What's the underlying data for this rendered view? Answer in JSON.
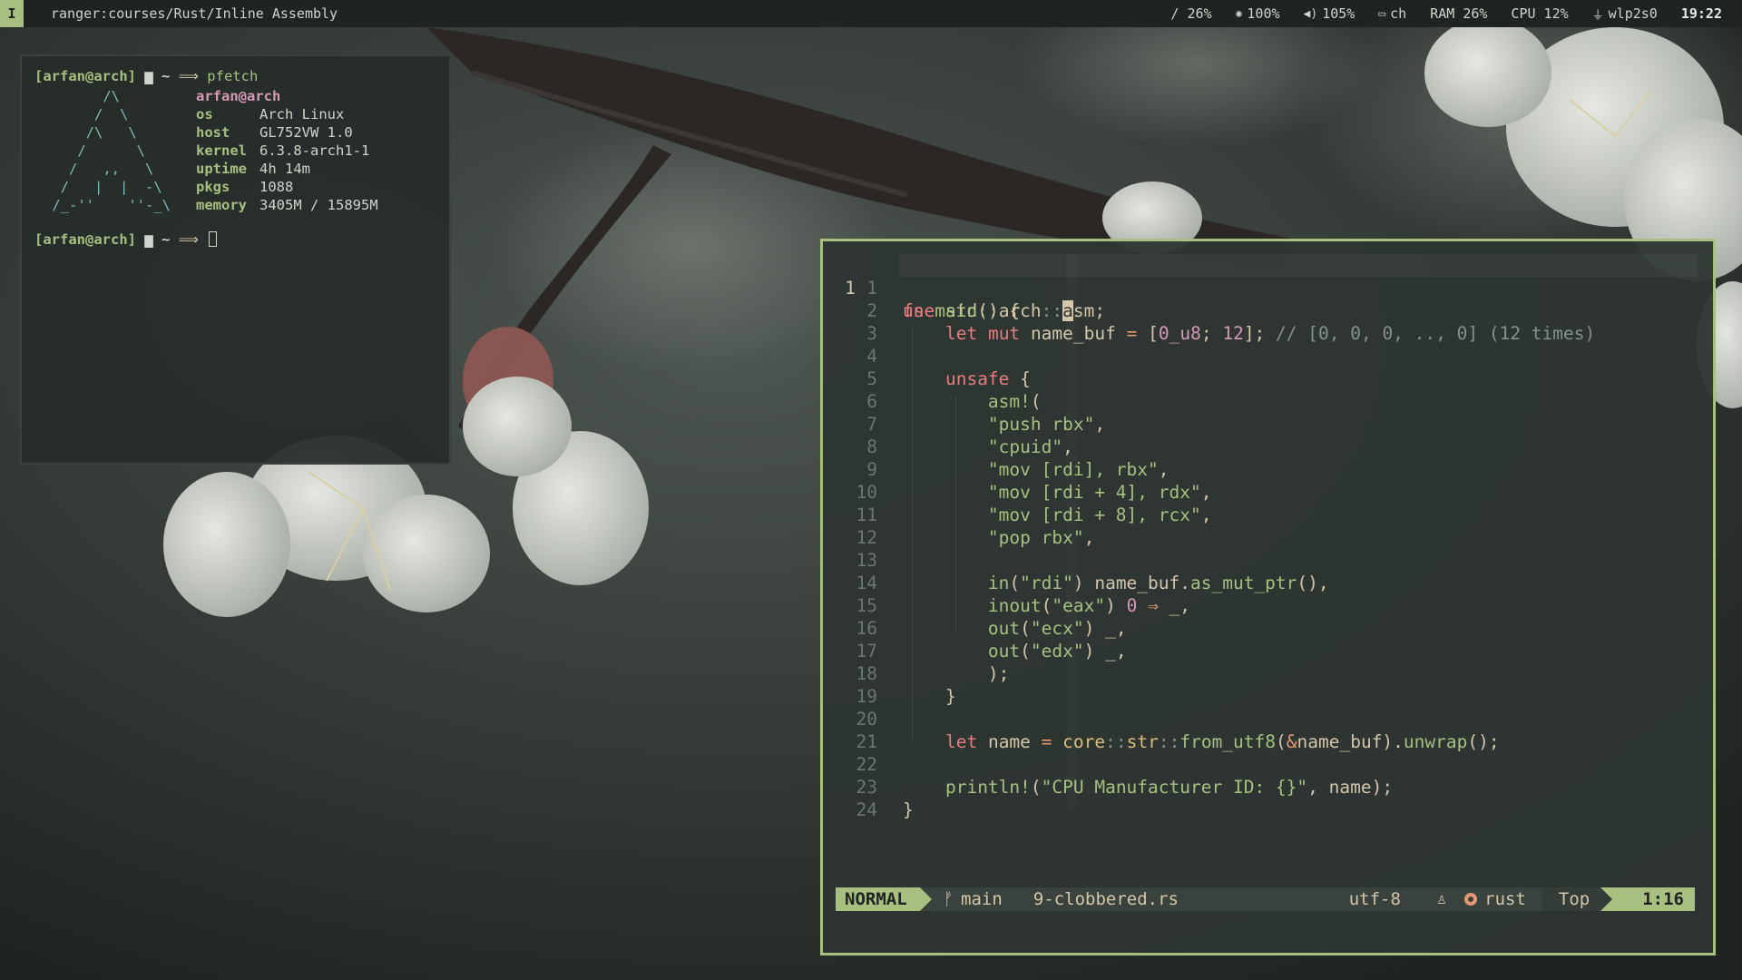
{
  "topbar": {
    "mode": "I",
    "window_title": "ranger:courses/Rust/Inline Assembly",
    "disk": "/ 26%",
    "brightness": "100%",
    "volume": "105%",
    "keyboard_layout": "ch",
    "ram": "RAM 26%",
    "cpu": "CPU 12%",
    "network": "wlp2s0",
    "clock": "19:22",
    "icons": [
      "brightness-icon",
      "volume-icon",
      "keyboard-icon",
      "network-icon"
    ]
  },
  "terminal": {
    "prompt_user": "[arfan@arch]",
    "prompt_dir": "~",
    "prompt_arrow": "⟹",
    "command": "pfetch",
    "ascii_logo": "       /\\\n      /  \\\n     /\\   \\\n    /      \\\n   /   ,,   \\\n  /   |  |  -\\\n /_-''    ''-_\\",
    "fetch_title": "arfan@arch",
    "fetch": [
      {
        "key": "os",
        "value": "Arch Linux"
      },
      {
        "key": "host",
        "value": "GL752VW 1.0"
      },
      {
        "key": "kernel",
        "value": "6.3.8-arch1-1"
      },
      {
        "key": "uptime",
        "value": "4h 14m"
      },
      {
        "key": "pkgs",
        "value": "1088"
      },
      {
        "key": "memory",
        "value": "3405M / 15895M"
      }
    ]
  },
  "editor": {
    "current_line_number": "1",
    "relative_numbers": [
      "1",
      "2",
      "3",
      "4",
      "5",
      "6",
      "7",
      "8",
      "9",
      "10",
      "11",
      "12",
      "13",
      "14",
      "15",
      "16",
      "17",
      "18",
      "19",
      "20",
      "21",
      "22",
      "23",
      "24"
    ],
    "statusline": {
      "mode": "NORMAL",
      "branch": "main",
      "filename": "9-clobbered.rs",
      "encoding": "utf-8",
      "filetype": "rust",
      "scroll": "Top",
      "position": "1:16"
    },
    "colors": {
      "accent": "#a7c080",
      "keyword": "#e67e80",
      "number": "#d699b6",
      "type": "#dbbc7f",
      "operator": "#e69875",
      "comment": "#859289",
      "foreground": "#d3c6aa"
    }
  }
}
